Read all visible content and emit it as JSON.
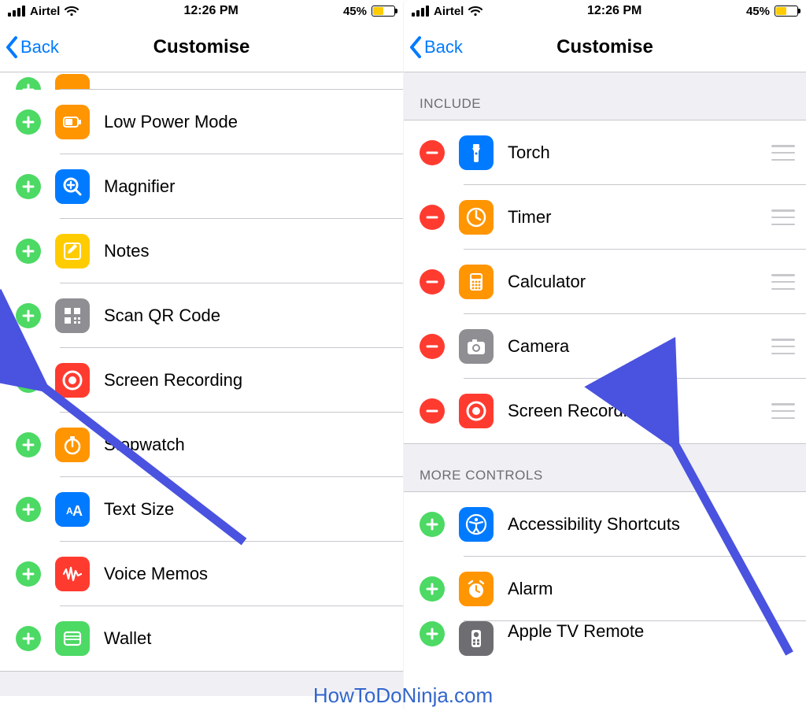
{
  "status": {
    "carrier": "Airtel",
    "time": "12:26 PM",
    "battery_pct": "45%",
    "battery_fill_pct": 45
  },
  "nav": {
    "back_label": "Back",
    "title": "Customise"
  },
  "left": {
    "rows": [
      {
        "kind": "add",
        "icon": "lowpower",
        "icon_bg": "bg-orange",
        "label": "Low Power Mode"
      },
      {
        "kind": "add",
        "icon": "magnifier",
        "icon_bg": "bg-blue",
        "label": "Magnifier"
      },
      {
        "kind": "add",
        "icon": "notes",
        "icon_bg": "bg-yellow",
        "label": "Notes"
      },
      {
        "kind": "add",
        "icon": "qr",
        "icon_bg": "bg-gray",
        "label": "Scan QR Code"
      },
      {
        "kind": "add",
        "icon": "record",
        "icon_bg": "bg-red",
        "label": "Screen Recording"
      },
      {
        "kind": "add",
        "icon": "stopwatch",
        "icon_bg": "bg-orange",
        "label": "Stopwatch"
      },
      {
        "kind": "add",
        "icon": "textsize",
        "icon_bg": "bg-blue",
        "label": "Text Size"
      },
      {
        "kind": "add",
        "icon": "voicememos",
        "icon_bg": "bg-red",
        "label": "Voice Memos"
      },
      {
        "kind": "add",
        "icon": "wallet",
        "icon_bg": "bg-green",
        "label": "Wallet"
      }
    ]
  },
  "right": {
    "section_include": "INCLUDE",
    "section_more": "MORE CONTROLS",
    "include": [
      {
        "kind": "remove",
        "icon": "torch",
        "icon_bg": "bg-blue",
        "label": "Torch",
        "drag": true
      },
      {
        "kind": "remove",
        "icon": "timer",
        "icon_bg": "bg-orange",
        "label": "Timer",
        "drag": true
      },
      {
        "kind": "remove",
        "icon": "calculator",
        "icon_bg": "bg-orange",
        "label": "Calculator",
        "drag": true
      },
      {
        "kind": "remove",
        "icon": "camera",
        "icon_bg": "bg-gray",
        "label": "Camera",
        "drag": true
      },
      {
        "kind": "remove",
        "icon": "record",
        "icon_bg": "bg-red",
        "label": "Screen Recording",
        "drag": true
      }
    ],
    "more": [
      {
        "kind": "add",
        "icon": "accessibility",
        "icon_bg": "bg-blue",
        "label": "Accessibility Shortcuts"
      },
      {
        "kind": "add",
        "icon": "alarm",
        "icon_bg": "bg-orange",
        "label": "Alarm"
      },
      {
        "kind": "add",
        "icon": "appletv",
        "icon_bg": "bg-darkgray",
        "label": "Apple TV Remote"
      }
    ]
  },
  "watermark": "HowToDoNinja.com"
}
